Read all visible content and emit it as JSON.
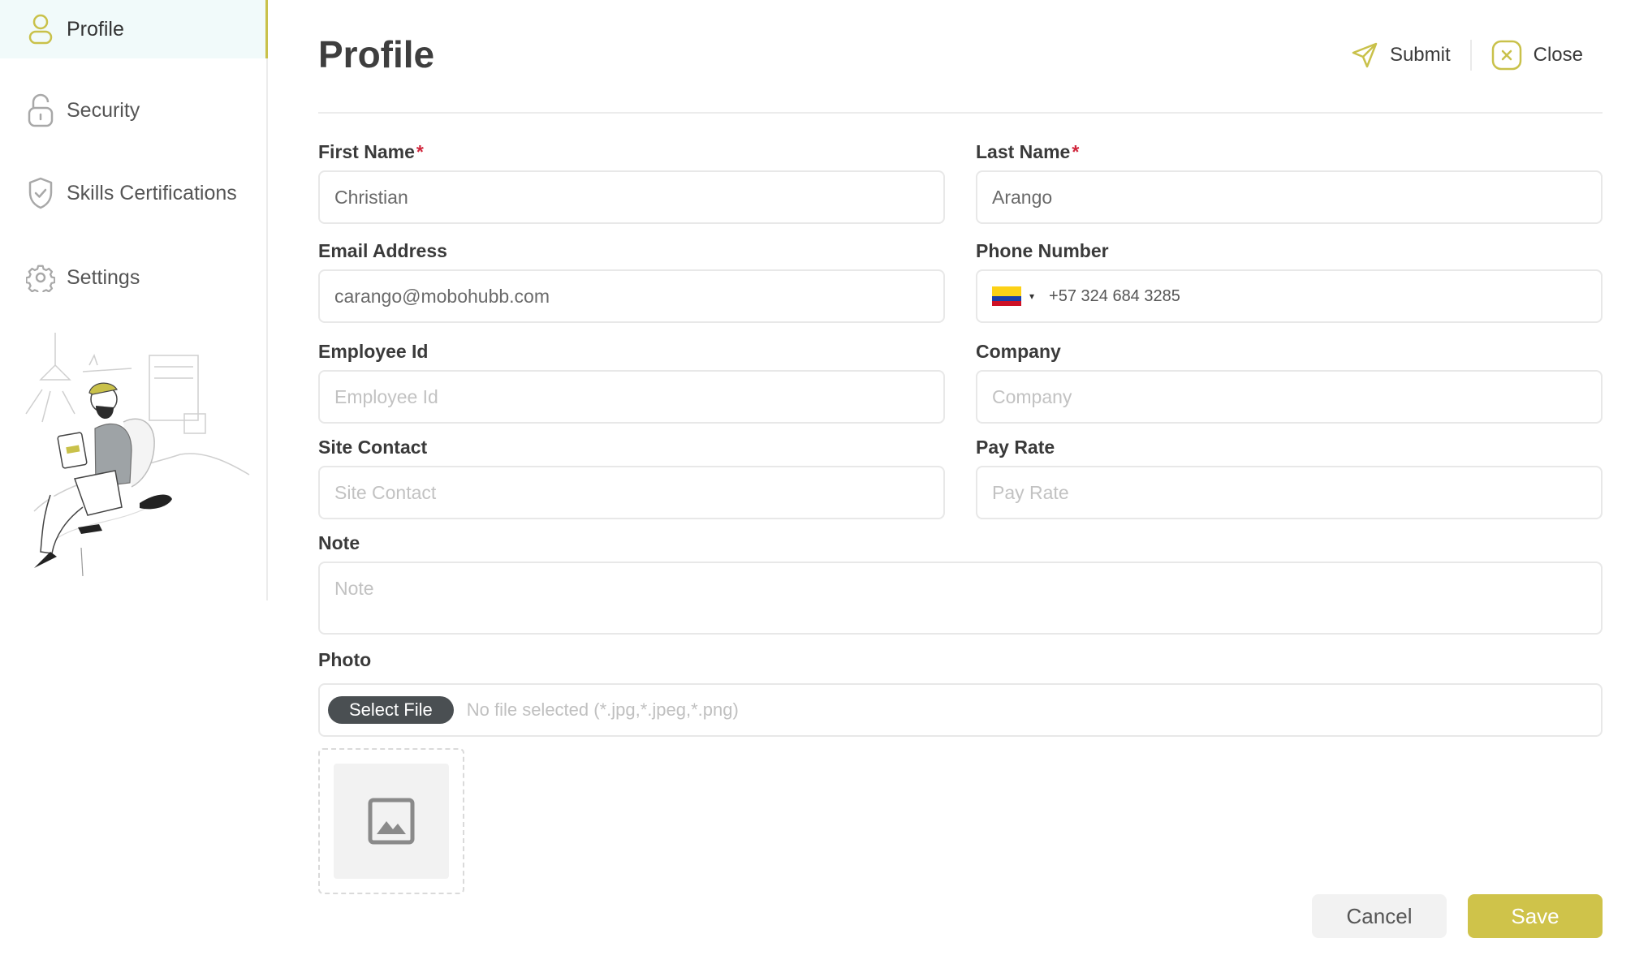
{
  "sidebar": {
    "items": [
      {
        "label": "Profile"
      },
      {
        "label": "Security"
      },
      {
        "label": "Skills Certifications"
      },
      {
        "label": "Settings"
      }
    ]
  },
  "header": {
    "title": "Profile",
    "submit_label": "Submit",
    "close_label": "Close"
  },
  "form": {
    "first_name": {
      "label": "First Name",
      "required": "*",
      "value": "Christian",
      "placeholder": "First Name"
    },
    "last_name": {
      "label": "Last Name",
      "required": "*",
      "value": "Arango",
      "placeholder": "Last Name"
    },
    "email": {
      "label": "Email Address",
      "value": "carango@mobohubb.com",
      "placeholder": "Email Address"
    },
    "phone": {
      "label": "Phone Number",
      "value": "+57 324 684 3285",
      "country_caret": "▾"
    },
    "employee_id": {
      "label": "Employee Id",
      "value": "",
      "placeholder": "Employee Id"
    },
    "company": {
      "label": "Company",
      "value": "",
      "placeholder": "Company"
    },
    "site_contact": {
      "label": "Site Contact",
      "value": "",
      "placeholder": "Site Contact"
    },
    "pay_rate": {
      "label": "Pay Rate",
      "value": "",
      "placeholder": "Pay Rate"
    },
    "note": {
      "label": "Note",
      "value": "",
      "placeholder": "Note"
    },
    "photo": {
      "label": "Photo",
      "button_label": "Select File",
      "hint": "No file selected (*.jpg,*.jpeg,*.png)"
    }
  },
  "footer": {
    "cancel_label": "Cancel",
    "save_label": "Save"
  },
  "colors": {
    "accent": "#cfc34a",
    "required": "#d0263c",
    "file_button": "#4a4f52",
    "active_nav_bg": "#f1fafa"
  }
}
